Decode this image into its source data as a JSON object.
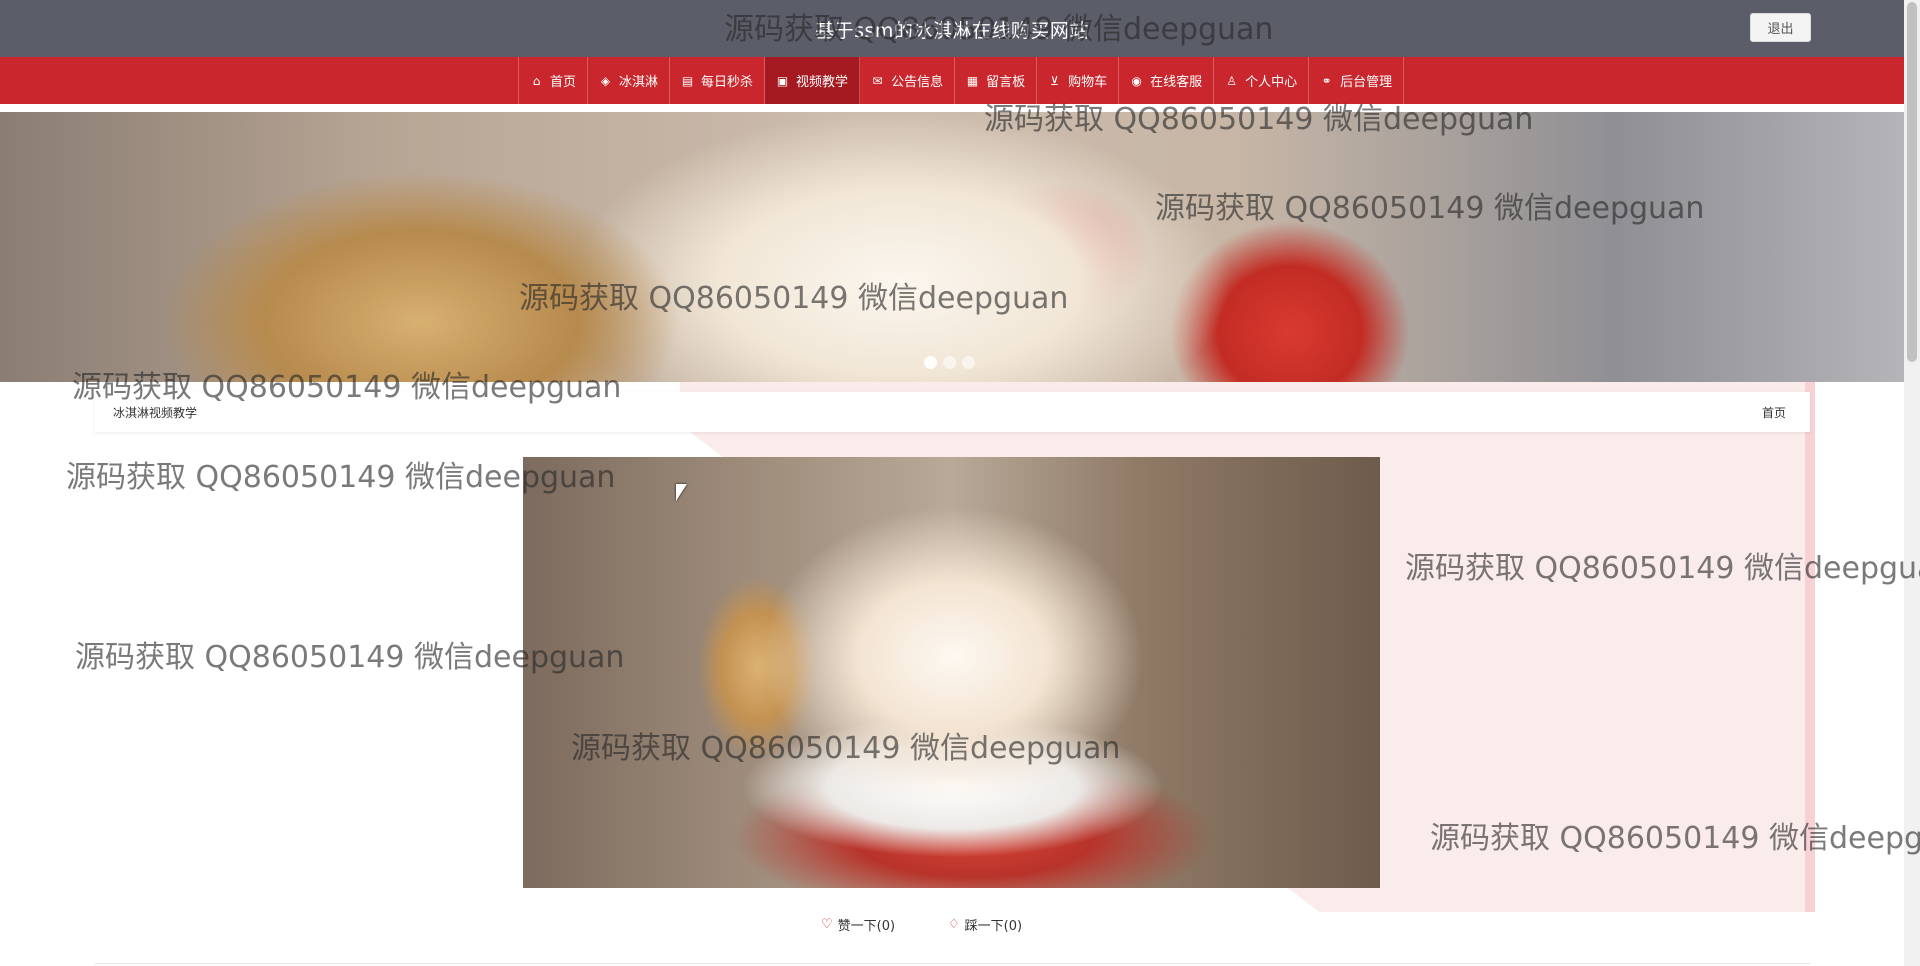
{
  "header": {
    "site_title": "基于ssm的冰淇淋在线购买网站",
    "logout_label": "退出"
  },
  "nav": {
    "items": [
      {
        "label": "首页",
        "icon": "home-icon",
        "glyph": "⌂",
        "active": false
      },
      {
        "label": "冰淇淋",
        "icon": "layers-icon",
        "glyph": "◈",
        "active": false
      },
      {
        "label": "每日秒杀",
        "icon": "calendar-icon",
        "glyph": "▤",
        "active": false
      },
      {
        "label": "视频教学",
        "icon": "video-edit-icon",
        "glyph": "▣",
        "active": true
      },
      {
        "label": "公告信息",
        "icon": "mail-icon",
        "glyph": "✉",
        "active": false
      },
      {
        "label": "留言板",
        "icon": "note-icon",
        "glyph": "▦",
        "active": false
      },
      {
        "label": "购物车",
        "icon": "cart-icon",
        "glyph": "⊻",
        "active": false
      },
      {
        "label": "在线客服",
        "icon": "chat-icon",
        "glyph": "◉",
        "active": false
      },
      {
        "label": "个人中心",
        "icon": "user-icon",
        "glyph": "♙",
        "active": false
      },
      {
        "label": "后台管理",
        "icon": "link-icon",
        "glyph": "⚭",
        "active": false
      }
    ]
  },
  "banner": {
    "slides": 3,
    "active_slide": 1
  },
  "content": {
    "title": "冰淇淋视频教学",
    "home_link": "首页"
  },
  "votes": {
    "like_label": "赞一下(0)",
    "dislike_label": "踩一下(0)"
  },
  "watermarks": {
    "text": "源码获取 QQ86050149 微信deepguan",
    "clipped_text": "源码获取 QQ86050149 微信deepgua",
    "clipped_text_2": "源码获取 QQ86050149 微信deepgu"
  },
  "colors": {
    "header_bg": "#5b5e69",
    "nav_bg": "#c9272d",
    "nav_active_bg": "#a51a20",
    "deco_pink": "#fbecec"
  }
}
